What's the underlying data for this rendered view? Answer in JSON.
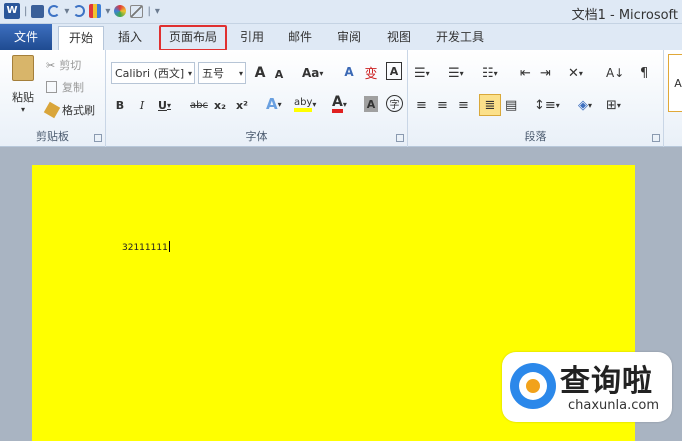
{
  "window": {
    "title": "文档1 - Microsoft"
  },
  "tabs": [
    {
      "label": "文件"
    },
    {
      "label": "开始"
    },
    {
      "label": "插入"
    },
    {
      "label": "页面布局"
    },
    {
      "label": "引用"
    },
    {
      "label": "邮件"
    },
    {
      "label": "审阅"
    },
    {
      "label": "视图"
    },
    {
      "label": "开发工具"
    }
  ],
  "clipboard": {
    "paste": "粘贴",
    "cut": "剪切",
    "copy": "复制",
    "format_painter": "格式刷",
    "label": "剪贴板"
  },
  "font": {
    "name": "Calibri (西文]",
    "size": "五号",
    "grow": "A",
    "shrink": "A",
    "case": "Aa",
    "clear": "A",
    "bold": "B",
    "italic": "I",
    "underline": "U",
    "strike": "abc",
    "subscript": "x₂",
    "superscript": "x²",
    "effects": "A",
    "highlight": "aby",
    "color": "A",
    "shading": "A",
    "enclose": "字",
    "phonetic": "变",
    "border": "A",
    "label": "字体"
  },
  "paragraph": {
    "label": "段落"
  },
  "document": {
    "text": "32111111"
  },
  "watermark": {
    "cn": "查询啦",
    "en": "chaxunla.com"
  },
  "colors": {
    "file_tab": "#2b579a",
    "highlight_box": "#e03030",
    "page": "#ffff00",
    "workspace": "#a9b4c2"
  }
}
